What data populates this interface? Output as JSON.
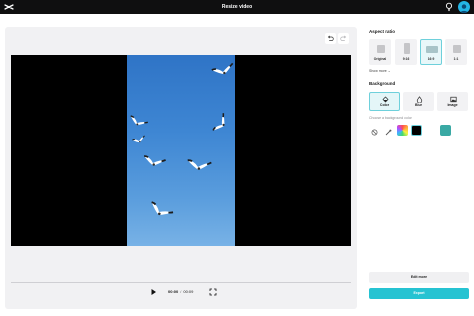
{
  "window": {
    "title": "Resize video"
  },
  "player": {
    "current_time": "00:00",
    "separator": "/",
    "duration": "00:09"
  },
  "aspect_ratio": {
    "title": "Aspect ratio",
    "options": [
      {
        "label": "Original"
      },
      {
        "label": "9:16"
      },
      {
        "label": "16:9"
      },
      {
        "label": "1:1"
      }
    ],
    "selected": "16:9",
    "show_more": "Show more"
  },
  "background": {
    "title": "Background",
    "options": [
      {
        "label": "Color"
      },
      {
        "label": "Blur"
      },
      {
        "label": "Image"
      }
    ],
    "selected": "Color",
    "prompt": "Choose a background color",
    "swatches": [
      {
        "name": "none",
        "color": "#ffffff"
      },
      {
        "name": "picker",
        "color": "#ffffff"
      },
      {
        "name": "gradient",
        "color": "#c04cf0"
      },
      {
        "name": "black",
        "color": "#000000"
      },
      {
        "name": "teal",
        "color": "#3aa9a4"
      }
    ]
  },
  "actions": {
    "edit_more": "Edit more",
    "export": "Export"
  },
  "colors": {
    "accent": "#26c3d2",
    "selected_border": "#6ed0db",
    "topbar": "#0f0f10"
  }
}
